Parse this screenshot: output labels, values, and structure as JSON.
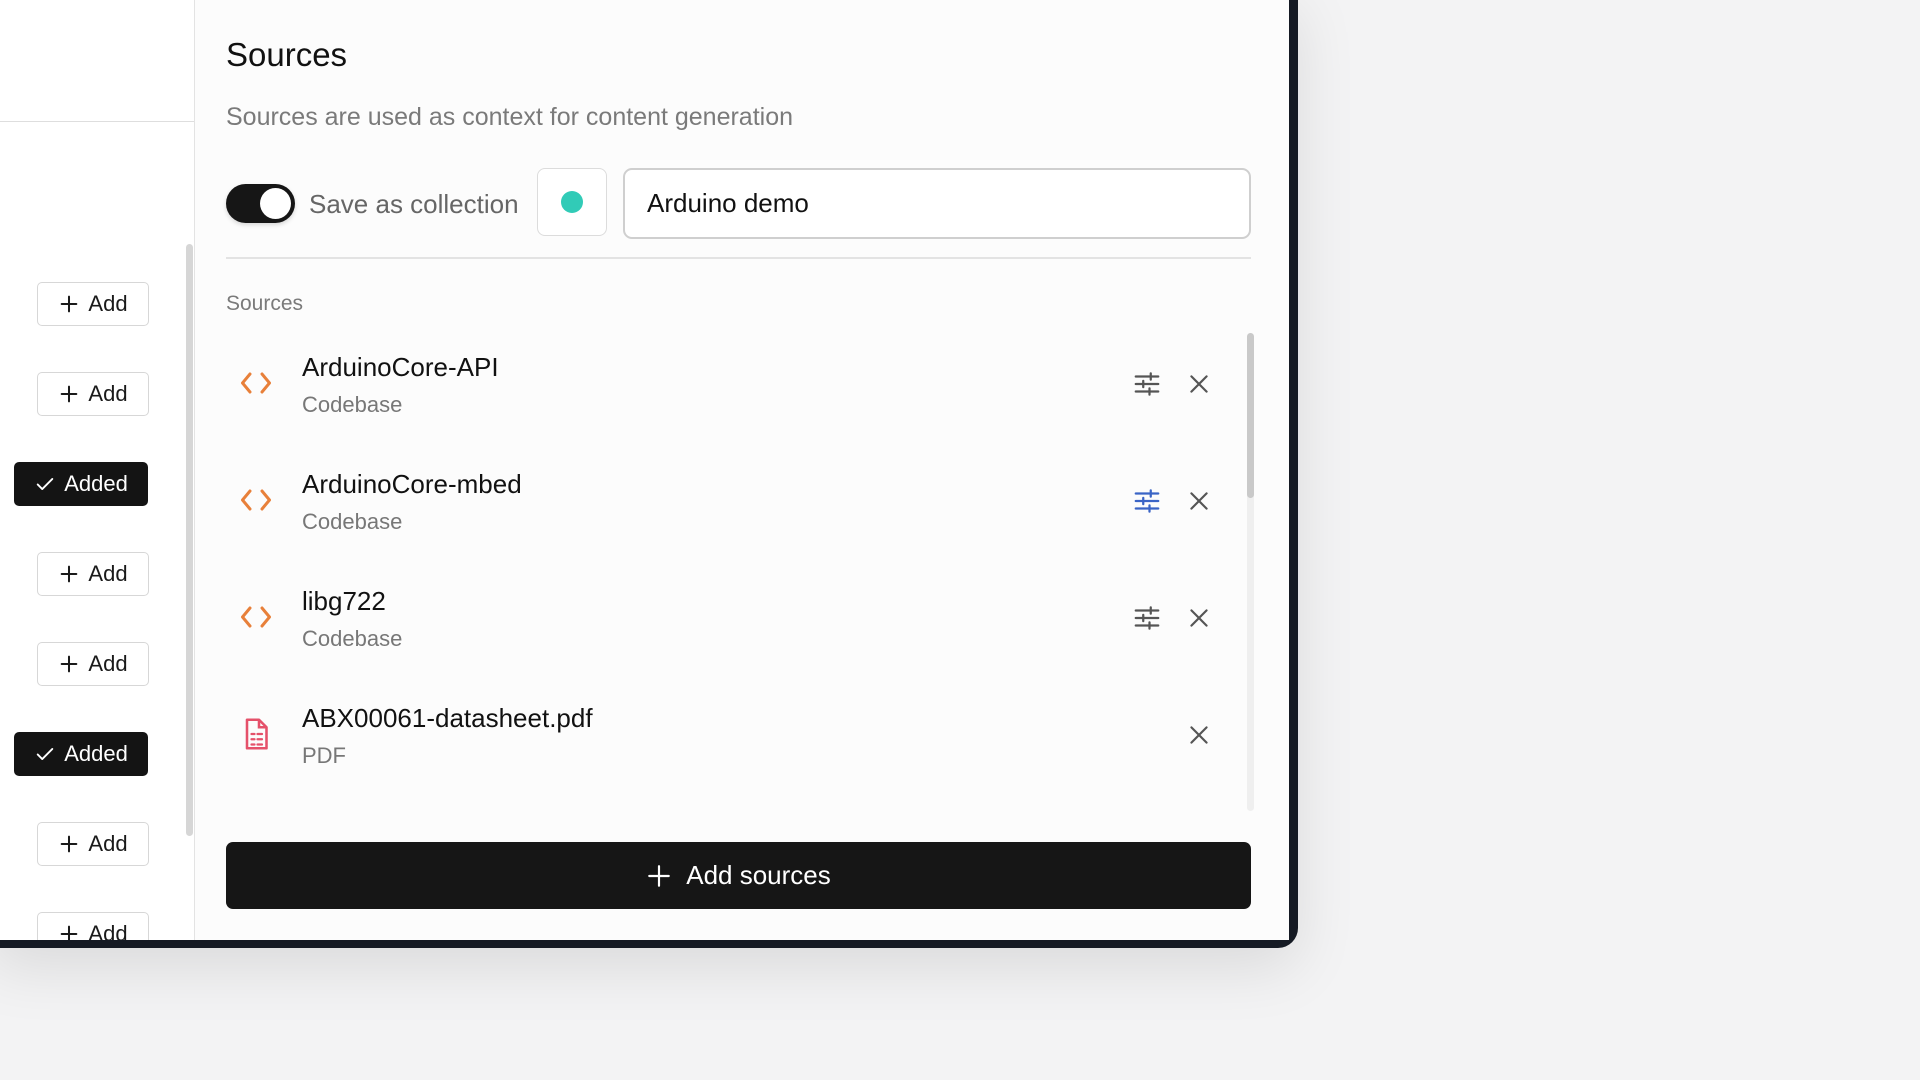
{
  "colors": {
    "accent": "#31cbb7",
    "primary_button": "#161616",
    "code_icon": "#e8803a",
    "pdf_icon": "#e5516a",
    "active_tune_icon": "#3a64c6"
  },
  "left_list": {
    "buttons": [
      {
        "label": "Add",
        "state": "add",
        "icon": "plus-icon"
      },
      {
        "label": "Add",
        "state": "add",
        "icon": "plus-icon"
      },
      {
        "label": "Added",
        "state": "added",
        "icon": "check-icon"
      },
      {
        "label": "Add",
        "state": "add",
        "icon": "plus-icon"
      },
      {
        "label": "Add",
        "state": "add",
        "icon": "plus-icon"
      },
      {
        "label": "Added",
        "state": "added",
        "icon": "check-icon"
      },
      {
        "label": "Add",
        "state": "add",
        "icon": "plus-icon"
      },
      {
        "label": "Add",
        "state": "add",
        "icon": "plus-icon"
      }
    ]
  },
  "panel": {
    "title": "Sources",
    "subtitle": "Sources are used as context for content generation",
    "collection": {
      "toggle_on": true,
      "toggle_label": "Save as collection",
      "color": "#31cbb7",
      "name_value": "Arduino demo"
    },
    "section_label": "Sources",
    "sources": [
      {
        "name": "ArduinoCore-API",
        "type": "Codebase",
        "icon": "code-icon",
        "tune": true,
        "tune_active": false
      },
      {
        "name": "ArduinoCore-mbed",
        "type": "Codebase",
        "icon": "code-icon",
        "tune": true,
        "tune_active": true
      },
      {
        "name": "libg722",
        "type": "Codebase",
        "icon": "code-icon",
        "tune": true,
        "tune_active": false
      },
      {
        "name": "ABX00061-datasheet.pdf",
        "type": "PDF",
        "icon": "pdf-file-icon",
        "tune": false,
        "tune_active": false
      }
    ],
    "add_sources_label": "Add sources"
  }
}
